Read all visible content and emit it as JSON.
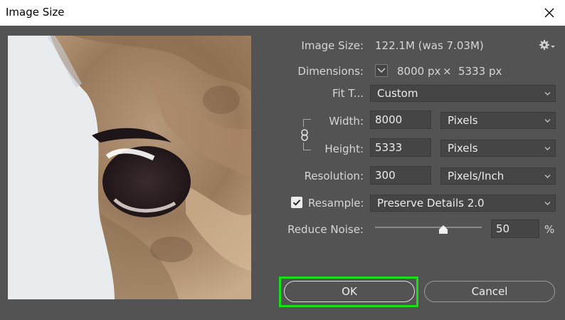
{
  "window": {
    "title": "Image Size",
    "close_icon": "close-icon"
  },
  "image_size": {
    "label": "Image Size:",
    "value": "122.1M (was 7.03M)",
    "settings_icon": "gear-icon"
  },
  "dimensions": {
    "label": "Dimensions:",
    "width_value": "8000 px",
    "times": "×",
    "height_value": "5333 px"
  },
  "fit_to": {
    "label": "Fit T...",
    "value": "Custom"
  },
  "width": {
    "label": "Width:",
    "value": "8000",
    "unit": "Pixels"
  },
  "height": {
    "label": "Height:",
    "value": "5333",
    "unit": "Pixels"
  },
  "resolution": {
    "label": "Resolution:",
    "value": "300",
    "unit": "Pixels/Inch"
  },
  "resample": {
    "label": "Resample:",
    "checked": true,
    "value": "Preserve Details 2.0"
  },
  "reduce_noise": {
    "label": "Reduce Noise:",
    "value": "50",
    "unit": "%",
    "slider_level": 0.64
  },
  "buttons": {
    "ok": "OK",
    "cancel": "Cancel"
  },
  "colors": {
    "dialog_bg": "#535353",
    "field_bg": "#454545",
    "highlight": "#18e018"
  }
}
